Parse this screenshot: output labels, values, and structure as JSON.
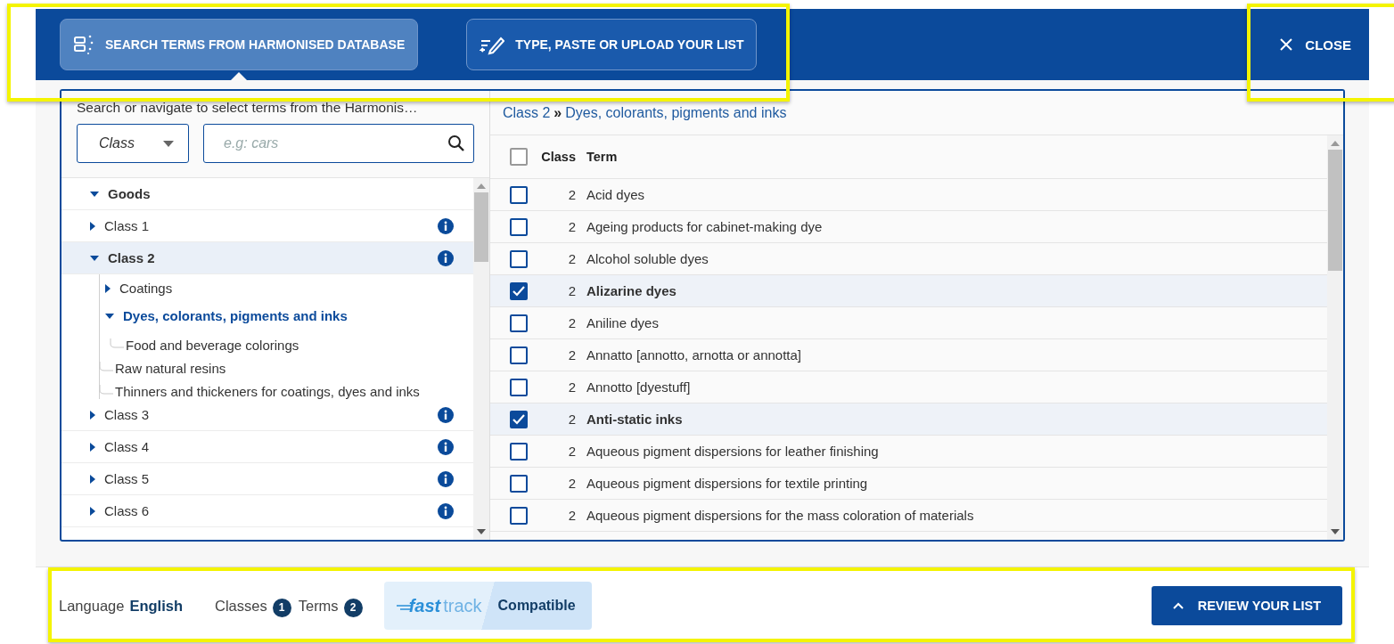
{
  "header": {
    "tabs": [
      {
        "label": "SEARCH TERMS FROM HARMONISED DATABASE",
        "kind": "database",
        "selected": true
      },
      {
        "label": "TYPE, PASTE OR UPLOAD YOUR LIST",
        "kind": "edit",
        "selected": false
      }
    ],
    "close_button": {
      "label": "CLOSE"
    }
  },
  "search": {
    "intro": "Search or navigate to select terms from the Harmonis…",
    "class_select": {
      "value": "Class"
    },
    "search_field": {
      "placeholder": "e.g: cars"
    }
  },
  "tree": [
    {
      "label": "Goods",
      "kind": "root",
      "expanded": true,
      "selected": false,
      "children": [
        {
          "label": "Class 1",
          "kind": "branch",
          "expanded": false,
          "selected": false,
          "info": true
        },
        {
          "label": "Class 2",
          "kind": "branch",
          "expanded": true,
          "selected": true,
          "info": true,
          "children": [
            {
              "label": "Coatings",
              "kind": "branch",
              "expanded": false,
              "selected": false
            },
            {
              "label": "Dyes, colorants, pigments and inks",
              "kind": "branch",
              "expanded": true,
              "selected": true,
              "children": [
                {
                  "label": "Food and beverage colorings",
                  "kind": "leaf",
                  "selected": false
                }
              ]
            },
            {
              "label": "Raw natural resins",
              "kind": "leaf",
              "selected": false
            },
            {
              "label": "Thinners and thickeners for coatings, dyes and inks",
              "kind": "leaf",
              "selected": false
            }
          ]
        },
        {
          "label": "Class 3",
          "kind": "branch",
          "expanded": false,
          "selected": false,
          "info": true
        },
        {
          "label": "Class 4",
          "kind": "branch",
          "expanded": false,
          "selected": false,
          "info": true
        },
        {
          "label": "Class 5",
          "kind": "branch",
          "expanded": false,
          "selected": false,
          "info": true
        },
        {
          "label": "Class 6",
          "kind": "branch",
          "expanded": false,
          "selected": false,
          "info": true
        }
      ]
    }
  ],
  "breadcrumb": {
    "parent": "Class 2",
    "separator": "»",
    "current": "Dyes, colorants, pigments and inks"
  },
  "table": {
    "select_all": {
      "checked": false
    },
    "columns": [
      "Class",
      "Term"
    ],
    "rows": [
      {
        "class": "2",
        "term": "Acid dyes",
        "checked": false
      },
      {
        "class": "2",
        "term": "Ageing products for cabinet-making dye",
        "checked": false
      },
      {
        "class": "2",
        "term": "Alcohol soluble dyes",
        "checked": false
      },
      {
        "class": "2",
        "term": "Alizarine dyes",
        "checked": true
      },
      {
        "class": "2",
        "term": "Aniline dyes",
        "checked": false
      },
      {
        "class": "2",
        "term": "Annatto [annotto, arnotta or annotta]",
        "checked": false
      },
      {
        "class": "2",
        "term": "Annotto [dyestuff]",
        "checked": false
      },
      {
        "class": "2",
        "term": "Anti-static inks",
        "checked": true
      },
      {
        "class": "2",
        "term": "Aqueous pigment dispersions for leather finishing",
        "checked": false
      },
      {
        "class": "2",
        "term": "Aqueous pigment dispersions for textile printing",
        "checked": false
      },
      {
        "class": "2",
        "term": "Aqueous pigment dispersions for the mass coloration of materials",
        "checked": false
      }
    ]
  },
  "footer": {
    "language_label": "Language",
    "language": "English",
    "classes_label": "Classes",
    "classes_count": "1",
    "terms_label": "Terms",
    "terms_count": "2",
    "fast_track": {
      "logo_fast": "fast",
      "logo_track": "track",
      "status": "Compatible"
    },
    "review_button": {
      "label": "REVIEW YOUR LIST"
    }
  }
}
